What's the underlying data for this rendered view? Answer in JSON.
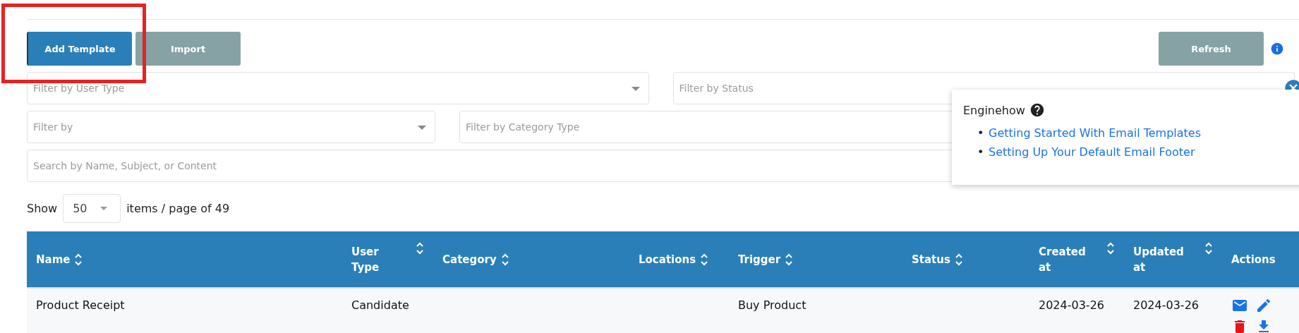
{
  "toolbar": {
    "buttons": [
      {
        "label": "Add Template",
        "kind": "primary"
      },
      {
        "label": "Import",
        "kind": "secondary"
      }
    ],
    "refresh": {
      "label": "Refresh"
    }
  },
  "annotation": {
    "kind": "highlight"
  },
  "filters": [
    [
      {
        "placeholder": "Filter by User Type",
        "kind": "select"
      },
      {
        "placeholder": "Filter by Status",
        "kind": "clearable"
      }
    ],
    [
      {
        "placeholder": "Filter by",
        "kind": "select"
      },
      {
        "placeholder": "Filter by Category Type",
        "kind": "input"
      }
    ],
    [
      {
        "placeholder": "Search by Name, Subject, or Content",
        "kind": "input"
      }
    ]
  ],
  "help_popup": {
    "title": "Enginehow",
    "bullet": "•",
    "links": [
      "Getting Started With Email Templates",
      "Setting Up Your Default Email Footer"
    ]
  },
  "pagination": {
    "label": "Show",
    "page_size": "50",
    "suffix": "items / page of 49"
  },
  "table": {
    "columns": [
      {
        "label": "Name",
        "sortable": true
      },
      {
        "label": "User Type",
        "sortable": true
      },
      {
        "label": "Category",
        "sortable": true
      },
      {
        "label": "Locations",
        "sortable": true
      },
      {
        "label": "Trigger",
        "sortable": true
      },
      {
        "label": "Status",
        "sortable": true
      },
      {
        "label": "Created at",
        "sortable": true
      },
      {
        "label": "Updated at",
        "sortable": true
      },
      {
        "label": "Actions",
        "sortable": false
      }
    ],
    "rows": [
      {
        "cells": [
          "Product Receipt",
          "Candidate",
          "",
          "",
          "Buy Product",
          "",
          "2024-03-26",
          "2024-03-26"
        ],
        "actions": [
          {
            "kind": "email"
          },
          {
            "kind": "edit"
          },
          {
            "kind": "delete"
          },
          {
            "kind": "download"
          }
        ]
      }
    ]
  }
}
